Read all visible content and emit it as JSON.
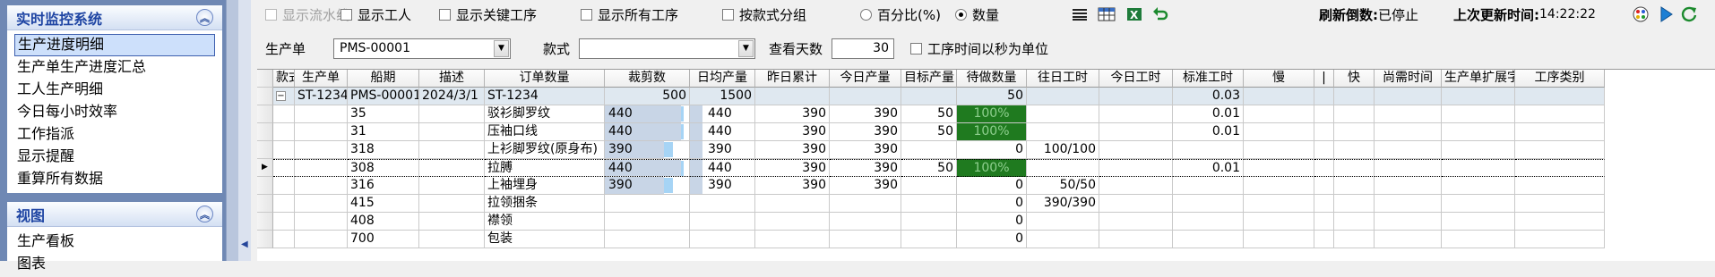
{
  "sidebar": {
    "panel1": {
      "title": "实时监控系统",
      "items": [
        "生产进度明细",
        "生产单生产进度汇总",
        "工人生产明细",
        "今日每小时效率",
        "工作指派",
        "显示提醒",
        "重算所有数据"
      ],
      "active_index": 0
    },
    "panel2": {
      "title": "视图",
      "items": [
        "生产看板",
        "图表"
      ]
    }
  },
  "toolbar": {
    "show_pipeline": "显示流水线",
    "show_workers": "显示工人",
    "show_key_process": "显示关键工序",
    "show_all_process": "显示所有工序",
    "group_by_style": "按款式分组",
    "radio_percent": "百分比(%)",
    "radio_number": "数量",
    "radio_selected": "数量",
    "refresh_label": "刷新倒数:",
    "refresh_value": "已停止",
    "last_update_label": "上次更新时间:",
    "last_update_value": "14:22:22",
    "icons": [
      "list-icon",
      "table-icon",
      "excel-export-icon",
      "undo-icon",
      "color-palette-icon",
      "play-icon",
      "refresh-icon"
    ]
  },
  "filters": {
    "order_label": "生产单",
    "order_value": "PMS-00001",
    "style_label": "款式",
    "style_value": "",
    "days_label": "查看天数",
    "days_value": "30",
    "seconds_unit_label": "工序时间以秒为单位"
  },
  "grid": {
    "columns": [
      "款式",
      "生产单",
      "船期",
      "描述",
      "订单数量",
      "裁剪数",
      "日均产量",
      "昨日累计",
      "今日产量",
      "目标产量",
      "待做数量",
      "往日工时",
      "今日工时",
      "标准工时",
      "慢",
      "|",
      "快",
      "尚需时间",
      "生产单扩展字段",
      "工序类别"
    ],
    "group": {
      "style": "ST-1234",
      "order": "PMS-00001",
      "ship_date": "2024/3/1",
      "desc": "ST-1234",
      "order_qty": "500",
      "cut_qty": "1500",
      "target": "50",
      "today_hours": "0.03"
    },
    "rows": [
      {
        "order": "35",
        "desc": "驳衫脚罗纹",
        "order_qty": "440",
        "cut_qty": "440",
        "daily_avg": "390",
        "yesterday": "390",
        "today": "50",
        "target": "100%",
        "pending": "",
        "today_hours": "0.01",
        "fill": 0.9
      },
      {
        "order": "31",
        "desc": "压袖口线",
        "order_qty": "440",
        "cut_qty": "440",
        "daily_avg": "390",
        "yesterday": "390",
        "today": "50",
        "target": "100%",
        "pending": "",
        "today_hours": "0.01",
        "fill": 0.9
      },
      {
        "order": "318",
        "desc": "上衫脚罗纹(原身布)",
        "order_qty": "390",
        "cut_qty": "390",
        "daily_avg": "390",
        "yesterday": "390",
        "today": "",
        "target": "0",
        "pending": "100/100",
        "today_hours": "",
        "fill": 0.7
      },
      {
        "order": "308",
        "desc": "拉膊",
        "order_qty": "440",
        "cut_qty": "440",
        "daily_avg": "390",
        "yesterday": "390",
        "today": "50",
        "target": "100%",
        "pending": "",
        "today_hours": "0.01",
        "fill": 0.9
      },
      {
        "order": "316",
        "desc": "上袖埋身",
        "order_qty": "390",
        "cut_qty": "390",
        "daily_avg": "390",
        "yesterday": "390",
        "today": "",
        "target": "0",
        "pending": "50/50",
        "today_hours": "",
        "fill": 0.7
      },
      {
        "order": "415",
        "desc": "拉领捆条",
        "order_qty": "",
        "cut_qty": "",
        "daily_avg": "",
        "yesterday": "",
        "today": "",
        "target": "0",
        "pending": "390/390",
        "today_hours": "",
        "fill": 0
      },
      {
        "order": "408",
        "desc": "襟领",
        "order_qty": "",
        "cut_qty": "",
        "daily_avg": "",
        "yesterday": "",
        "today": "",
        "target": "0",
        "pending": "",
        "today_hours": "",
        "fill": 0
      },
      {
        "order": "700",
        "desc": "包装",
        "order_qty": "",
        "cut_qty": "",
        "daily_avg": "",
        "yesterday": "",
        "today": "",
        "target": "0",
        "pending": "",
        "today_hours": "",
        "fill": 0
      }
    ],
    "selected_row": 3
  }
}
